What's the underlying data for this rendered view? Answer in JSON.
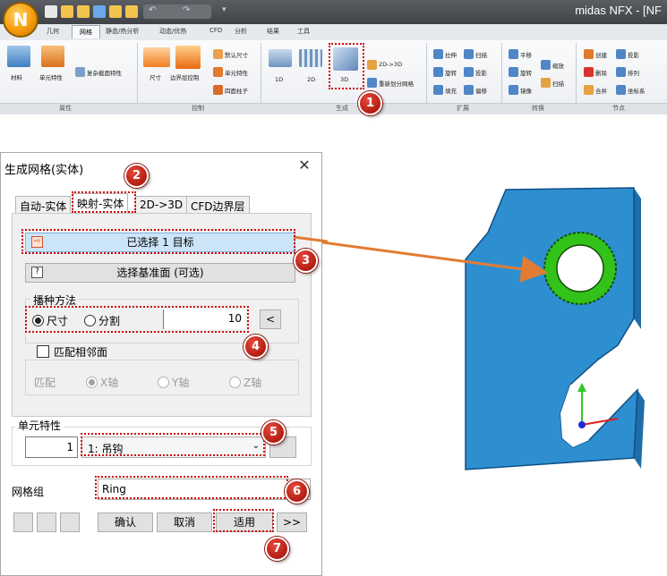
{
  "app": {
    "title": "midas NFX - [NF",
    "logo_letter": "N",
    "tabs": [
      "几何",
      "网格",
      "静态/热分析",
      "动态/优热",
      "CFD",
      "分析",
      "结果",
      "工具"
    ],
    "active_tab_index": 1
  },
  "ribbon": {
    "groups": [
      {
        "label": "属性",
        "buttons": [
          "材料",
          "单元特性"
        ],
        "small": [
          "复杂截面特性"
        ]
      },
      {
        "label": "控制",
        "buttons": [
          "尺寸",
          "边界层控制"
        ],
        "small": [
          "默认尺寸",
          "单元特性",
          "四面柱子"
        ]
      },
      {
        "label": "生成",
        "buttons": [
          "1D",
          "2D",
          "3D"
        ],
        "small": [
          "2D->3D",
          "重新划分网格"
        ]
      },
      {
        "label": "扩展",
        "small": [
          "拉伸",
          "扫描",
          "旋转",
          "投影",
          "填充",
          "偏移"
        ]
      },
      {
        "label": "转换",
        "small": [
          "平移",
          "缩放",
          "旋转",
          "镜像",
          "扫描"
        ]
      },
      {
        "label": "节点",
        "small": [
          "创建",
          "投影",
          "删除",
          "排列",
          "合并",
          "坐标系"
        ]
      }
    ]
  },
  "dialog": {
    "title": "生成网格(实体)",
    "close": "✕",
    "tabs": [
      "自动-实体",
      "映射-实体",
      "2D->3D",
      "CFD边界层"
    ],
    "active_tab_index": 1,
    "select_target_label": "已选择 1 目标",
    "select_base_label": "选择基准面 (可选)",
    "seed_method": {
      "legend": "播种方法",
      "options": [
        "尺寸",
        "分割"
      ],
      "selected": "尺寸",
      "value": "10",
      "arrow": "<"
    },
    "match_adjacent": {
      "label": "匹配相邻面",
      "checked": false,
      "match_label": "匹配",
      "axes": [
        "X轴",
        "Y轴",
        "Z轴"
      ],
      "selected_axis": "X轴"
    },
    "element_property": {
      "legend": "单元特性",
      "id": "1",
      "selected": "1: 吊钩"
    },
    "mesh_group": {
      "label": "网格组",
      "value": "Ring"
    },
    "buttons": {
      "ok": "确认",
      "cancel": "取消",
      "apply": "适用",
      "more": ">>"
    }
  },
  "callouts": [
    "1",
    "2",
    "3",
    "4",
    "5",
    "6",
    "7"
  ],
  "colors": {
    "model_fill": "#2e8fd0",
    "ring_fill": "#33c21a",
    "callout": "#b21d12",
    "arrow": "#e27b33"
  }
}
